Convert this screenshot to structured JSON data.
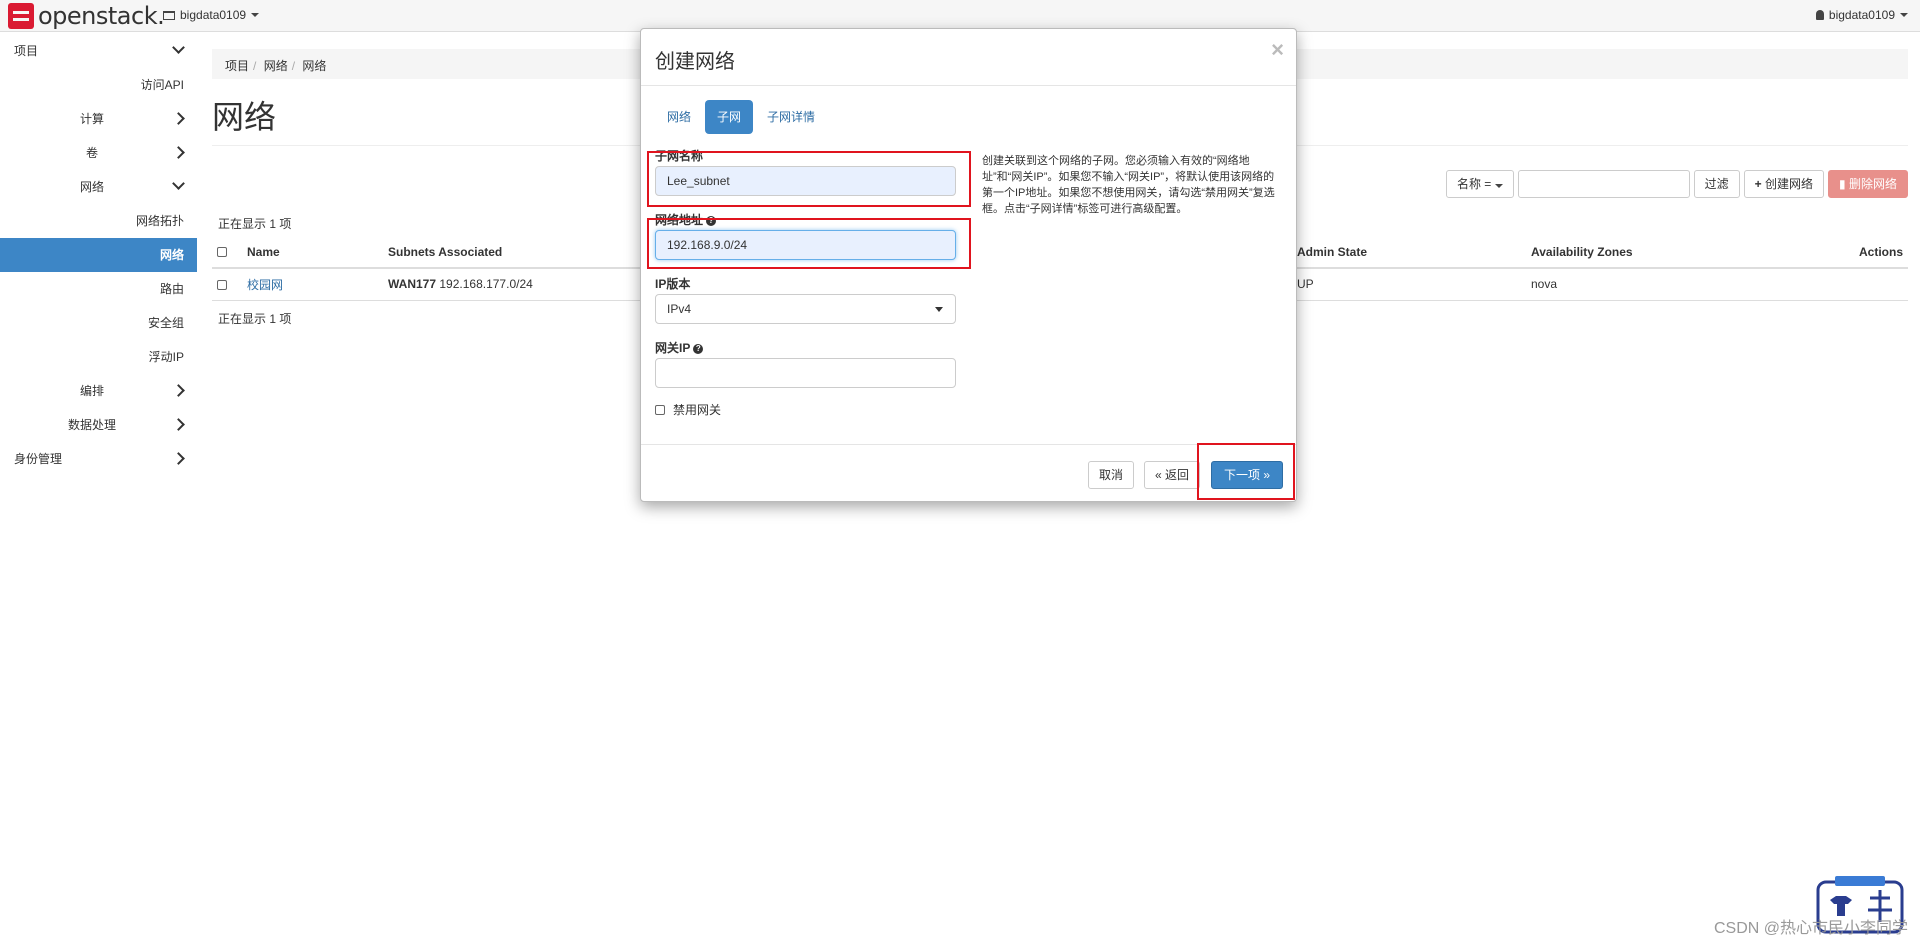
{
  "topbar": {
    "brand": "openstack.",
    "project": "bigdata0109",
    "user": "bigdata0109"
  },
  "sidebar": {
    "items": [
      {
        "label": "项目",
        "chevron": "down"
      },
      {
        "label": "访问API"
      },
      {
        "label": "计算",
        "chevron": "right"
      },
      {
        "label": "卷",
        "chevron": "right"
      },
      {
        "label": "网络",
        "chevron": "down"
      },
      {
        "label": "网络拓扑"
      },
      {
        "label": "网络",
        "active": true
      },
      {
        "label": "路由"
      },
      {
        "label": "安全组"
      },
      {
        "label": "浮动IP"
      },
      {
        "label": "编排",
        "chevron": "right"
      },
      {
        "label": "数据处理",
        "chevron": "right"
      },
      {
        "label": "身份管理",
        "chevron": "right"
      }
    ]
  },
  "breadcrumb": [
    "项目",
    "网络",
    "网络"
  ],
  "page_title": "网络",
  "toolbar": {
    "filter_select": "名称 =",
    "filter_button": "过滤",
    "create_button": "创建网络",
    "delete_button": "删除网络"
  },
  "table": {
    "count_text": "正在显示 1 项",
    "headers": [
      "Name",
      "Subnets Associated",
      "Admin State",
      "Availability Zones",
      "Actions"
    ],
    "rows": [
      {
        "name": "校园网",
        "subnet_name": "WAN177",
        "subnet_cidr": "192.168.177.0/24",
        "admin_state": "UP",
        "zone": "nova"
      }
    ]
  },
  "modal": {
    "title": "创建网络",
    "close": "×",
    "tabs": [
      "网络",
      "子网",
      "子网详情"
    ],
    "active_tab": "子网",
    "subnet_name_label": "子网名称",
    "subnet_name_value": "Lee_subnet",
    "network_address_label": "网络地址",
    "network_address_value": "192.168.9.0/24",
    "ip_version_label": "IP版本",
    "ip_version_value": "IPv4",
    "gateway_ip_label": "网关IP",
    "gateway_ip_value": "",
    "disable_gateway_label": "禁用网关",
    "help_text": "创建关联到这个网络的子网。您必须输入有效的“网络地址”和“网关IP”。如果您不输入“网关IP”，将默认使用该网络的第一个IP地址。如果您不想使用网关，请勾选“禁用网关”复选框。点击“子网详情”标签可进行高级配置。",
    "cancel_button": "取消",
    "back_button": "« 返回",
    "next_button": "下一项 »"
  },
  "watermark": "CSDN @热心市民小李同学"
}
